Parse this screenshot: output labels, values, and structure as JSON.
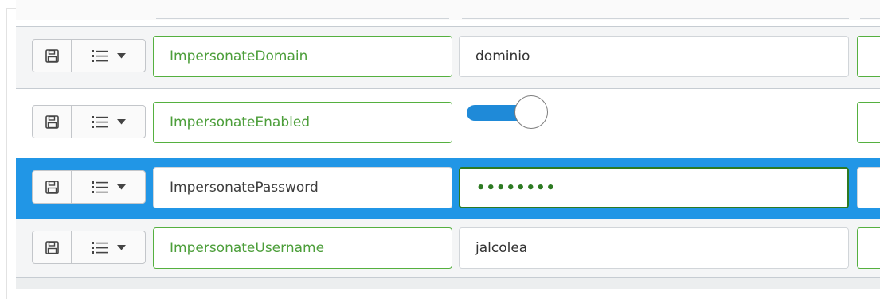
{
  "rows": [
    {
      "name": "ImpersonateDomain",
      "value": "dominio",
      "type": "text"
    },
    {
      "name": "ImpersonateEnabled",
      "value": "",
      "type": "toggle",
      "on": true
    },
    {
      "name": "ImpersonatePassword",
      "value": "••••••••",
      "type": "password",
      "selected": true
    },
    {
      "name": "ImpersonateUsername",
      "value": "jalcolea",
      "type": "text"
    }
  ],
  "icons": {
    "save": "floppy-disk-icon",
    "menu": "list-icon",
    "dropdown": "caret-down-icon"
  },
  "colors": {
    "selected_row": "#2196e6",
    "field_border_valid": "#55b03f",
    "toggle_on": "#1f8ad8"
  }
}
